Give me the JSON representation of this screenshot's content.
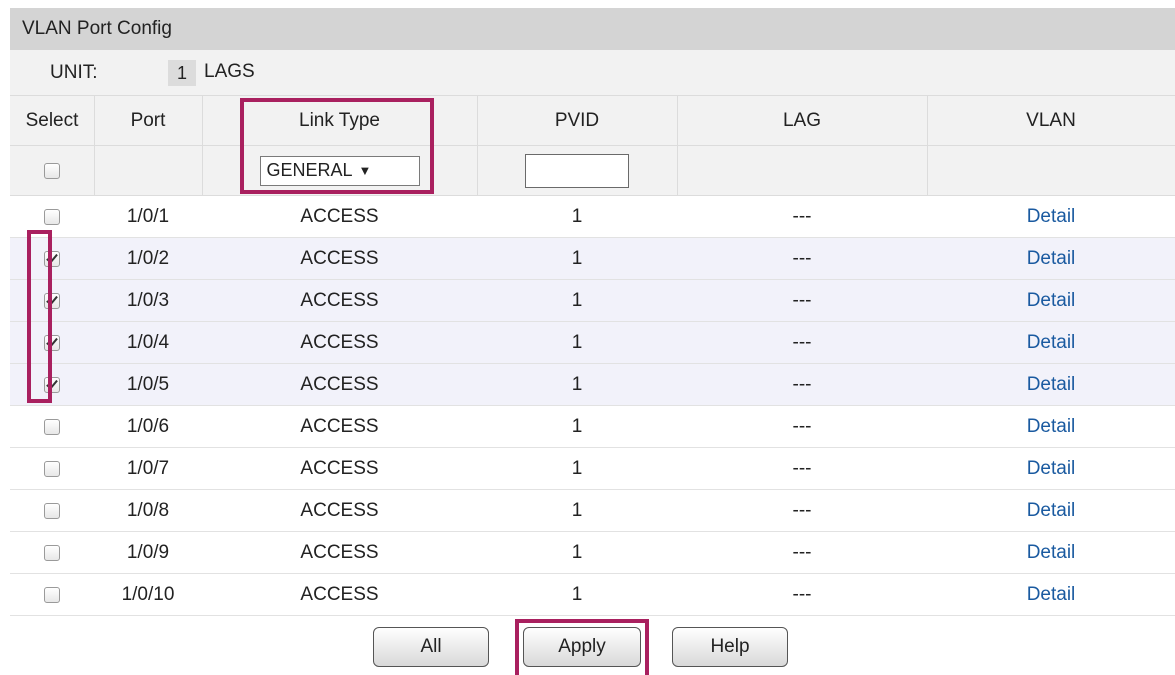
{
  "panel": {
    "title": "VLAN Port Config"
  },
  "unit": {
    "label": "UNIT:",
    "number": "1",
    "lags_label": "LAGS"
  },
  "columns": [
    "Select",
    "Port",
    "Link Type",
    "PVID",
    "LAG",
    "VLAN"
  ],
  "edit_row": {
    "link_type_selected": "GENERAL",
    "pvid_value": ""
  },
  "rows": [
    {
      "checked": false,
      "port": "1/0/1",
      "link_type": "ACCESS",
      "pvid": "1",
      "lag": "---",
      "vlan": "Detail"
    },
    {
      "checked": true,
      "port": "1/0/2",
      "link_type": "ACCESS",
      "pvid": "1",
      "lag": "---",
      "vlan": "Detail"
    },
    {
      "checked": true,
      "port": "1/0/3",
      "link_type": "ACCESS",
      "pvid": "1",
      "lag": "---",
      "vlan": "Detail"
    },
    {
      "checked": true,
      "port": "1/0/4",
      "link_type": "ACCESS",
      "pvid": "1",
      "lag": "---",
      "vlan": "Detail"
    },
    {
      "checked": true,
      "port": "1/0/5",
      "link_type": "ACCESS",
      "pvid": "1",
      "lag": "---",
      "vlan": "Detail"
    },
    {
      "checked": false,
      "port": "1/0/6",
      "link_type": "ACCESS",
      "pvid": "1",
      "lag": "---",
      "vlan": "Detail"
    },
    {
      "checked": false,
      "port": "1/0/7",
      "link_type": "ACCESS",
      "pvid": "1",
      "lag": "---",
      "vlan": "Detail"
    },
    {
      "checked": false,
      "port": "1/0/8",
      "link_type": "ACCESS",
      "pvid": "1",
      "lag": "---",
      "vlan": "Detail"
    },
    {
      "checked": false,
      "port": "1/0/9",
      "link_type": "ACCESS",
      "pvid": "1",
      "lag": "---",
      "vlan": "Detail"
    },
    {
      "checked": false,
      "port": "1/0/10",
      "link_type": "ACCESS",
      "pvid": "1",
      "lag": "---",
      "vlan": "Detail"
    }
  ],
  "buttons": {
    "all": "All",
    "apply": "Apply",
    "help": "Help"
  },
  "colors": {
    "highlight": "#a9205f",
    "link": "#1a5aa0",
    "title_bar": "#d4d4d4",
    "selected_row": "#f2f2fa"
  }
}
